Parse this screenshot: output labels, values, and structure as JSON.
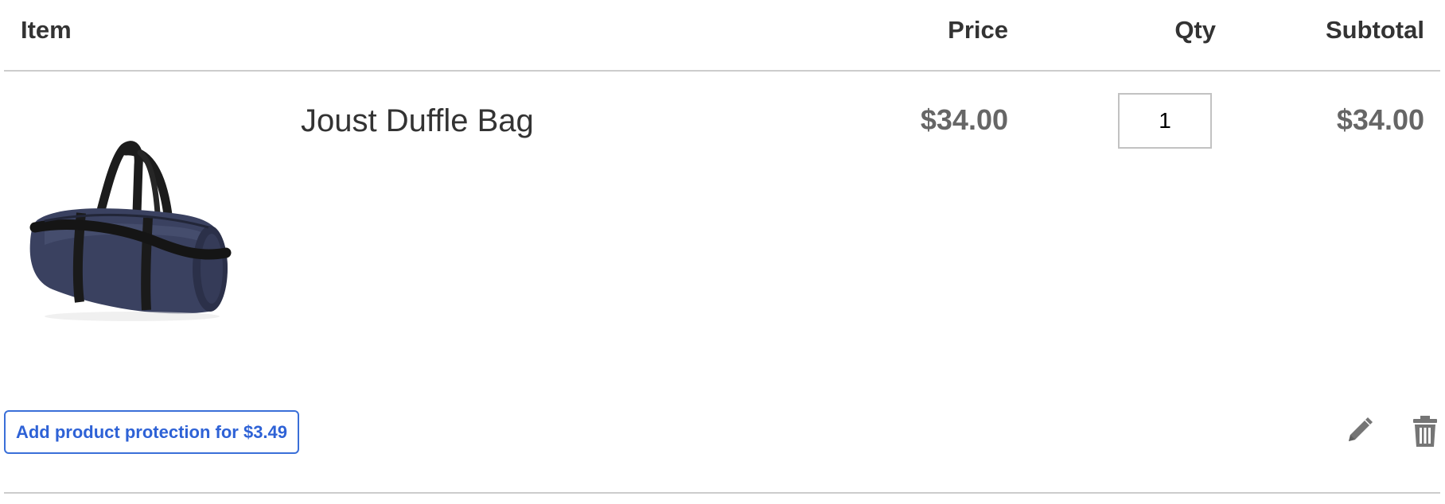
{
  "table": {
    "headers": {
      "item": "Item",
      "price": "Price",
      "qty": "Qty",
      "subtotal": "Subtotal"
    },
    "rows": [
      {
        "image": "duffle-bag-image",
        "name": "Joust Duffle Bag",
        "price": "$34.00",
        "qty": "1",
        "subtotal": "$34.00"
      }
    ]
  },
  "protection": {
    "label": "Add product protection for $3.49"
  },
  "actions": {
    "edit_icon": "pencil-icon",
    "delete_icon": "trash-icon"
  },
  "colors": {
    "header_text": "#333333",
    "price_text": "#666666",
    "link_blue": "#2e62d6",
    "icon_gray": "#757575",
    "rule": "#cccccc"
  }
}
